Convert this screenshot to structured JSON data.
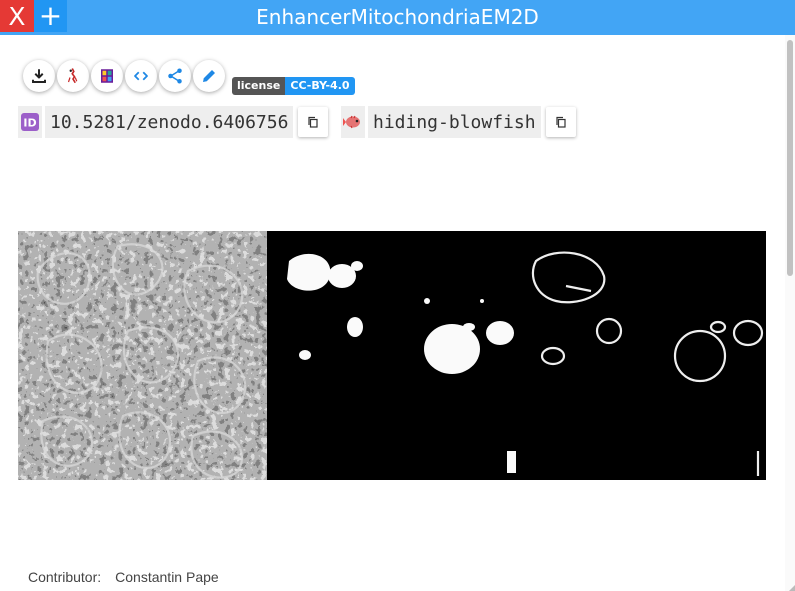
{
  "window": {
    "title": "EnhancerMitochondriaEM2D",
    "close_label": "X",
    "add_label": "+"
  },
  "toolbar": {
    "buttons": [
      "download-icon",
      "ilastik-icon",
      "imagej-icon",
      "code-icon",
      "share-icon",
      "edit-icon"
    ]
  },
  "license": {
    "label": "license",
    "value": "CC-BY-4.0"
  },
  "identifiers": {
    "doi": "10.5281/zenodo.6406756",
    "nickname": "hiding-blowfish"
  },
  "contributor": {
    "label": "Contributor:",
    "name": "Constantin Pape"
  },
  "colors": {
    "topbar": "#42a5f5",
    "close": "#e53935",
    "add": "#2196f3",
    "license_value_bg": "#2196f3",
    "id_icon": "#9c5fc9"
  }
}
